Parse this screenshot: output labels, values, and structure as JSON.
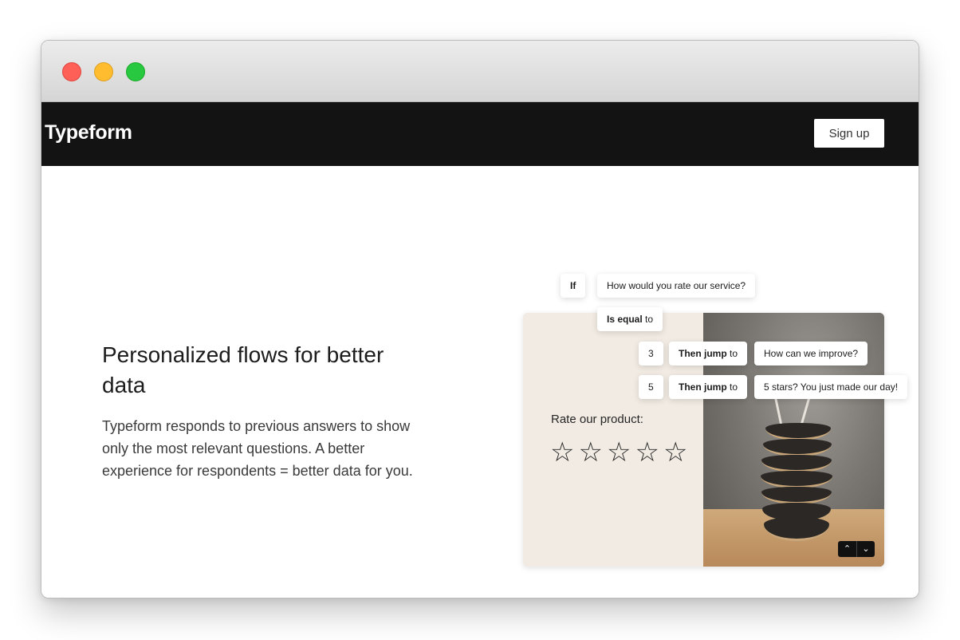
{
  "window": {
    "controls": [
      "close",
      "minimize",
      "zoom"
    ]
  },
  "navbar": {
    "logo": "Typeform",
    "signup_label": "Sign up"
  },
  "hero": {
    "heading": "Personalized flows for better data",
    "body": "Typeform responds to previous answers to show only the most relevant questions. A better experience for respondents = better data for you."
  },
  "logic": {
    "if_label": "If",
    "question": "How would you rate our service?",
    "is_equal_bold": "Is equal",
    "is_equal_rest": " to",
    "rules": [
      {
        "value": "3",
        "then_bold": "Then jump",
        "then_rest": " to",
        "target": "How can we improve?"
      },
      {
        "value": "5",
        "then_bold": "Then jump",
        "then_rest": " to",
        "target": "5 stars? You just made our day!"
      }
    ]
  },
  "card": {
    "rate_label": "Rate our product:",
    "stars_total": 5,
    "stars_selected": 0,
    "star_glyph": "☆",
    "nav_up": "⌃",
    "nav_down": "⌄"
  }
}
